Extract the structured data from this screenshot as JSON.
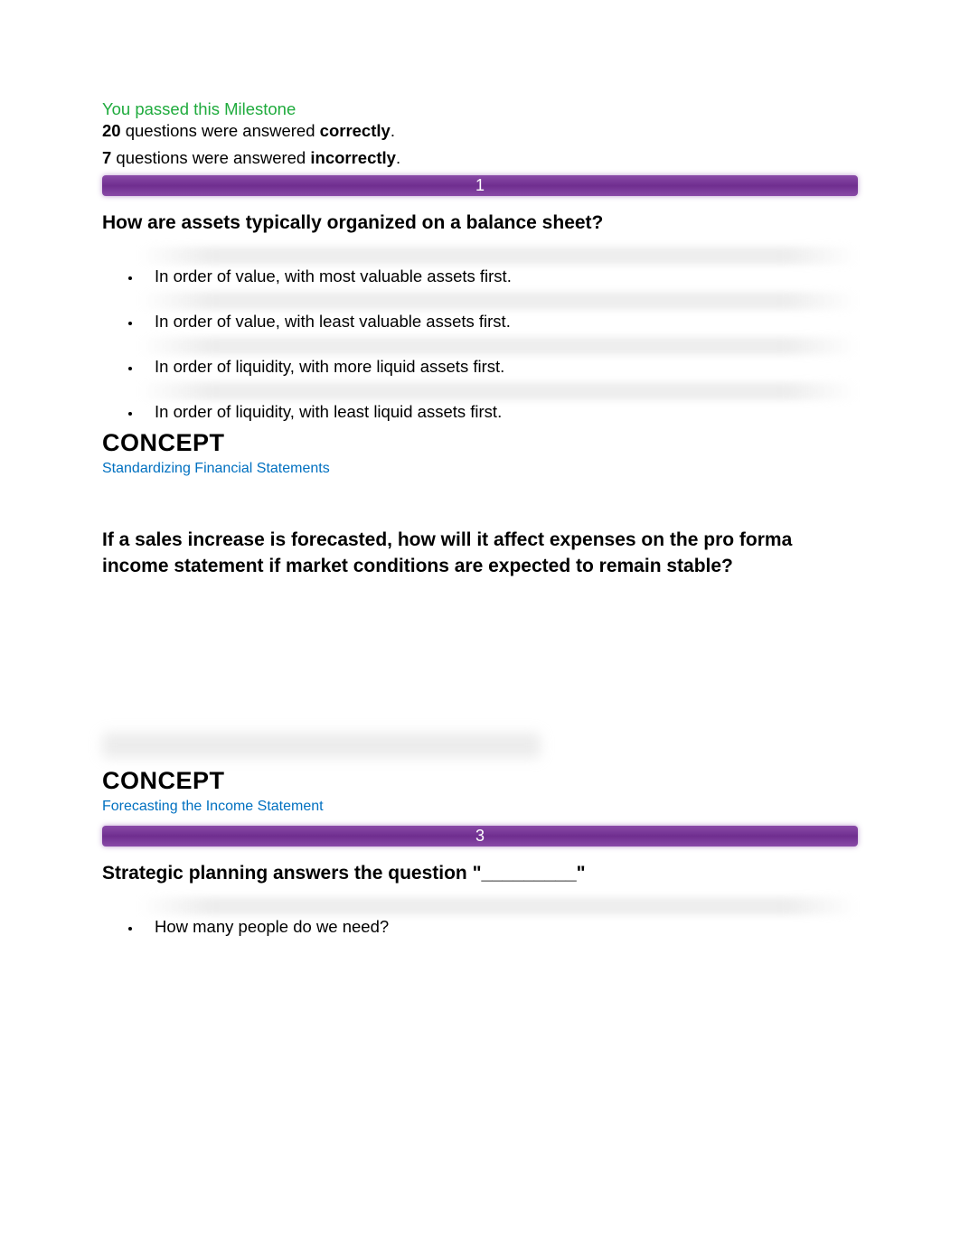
{
  "header": {
    "passed": "You passed this Milestone",
    "correct_count": "20",
    "correct_text_mid": " questions were answered ",
    "correct_word": "correctly",
    "incorrect_count": "7",
    "incorrect_word": "incorrectly",
    "period": "."
  },
  "q1": {
    "number": "1",
    "question": "How are assets typically organized on a balance sheet?",
    "answers": [
      "In order of value, with most valuable assets first.",
      "In order of value, with least valuable assets first.",
      "In order of liquidity, with more liquid assets first.",
      "In order of liquidity, with least liquid assets first."
    ],
    "concept_label": "CONCEPT",
    "concept_link": "Standardizing Financial Statements"
  },
  "q2": {
    "question": "If a sales increase is forecasted, how will it affect expenses on the pro forma income statement if market conditions are expected to remain stable?",
    "concept_label": "CONCEPT",
    "concept_link": "Forecasting the Income Statement"
  },
  "q3": {
    "number": "3",
    "question": "Strategic planning answers the question \"_________\"",
    "answers": [
      "How many people do we need?"
    ]
  }
}
